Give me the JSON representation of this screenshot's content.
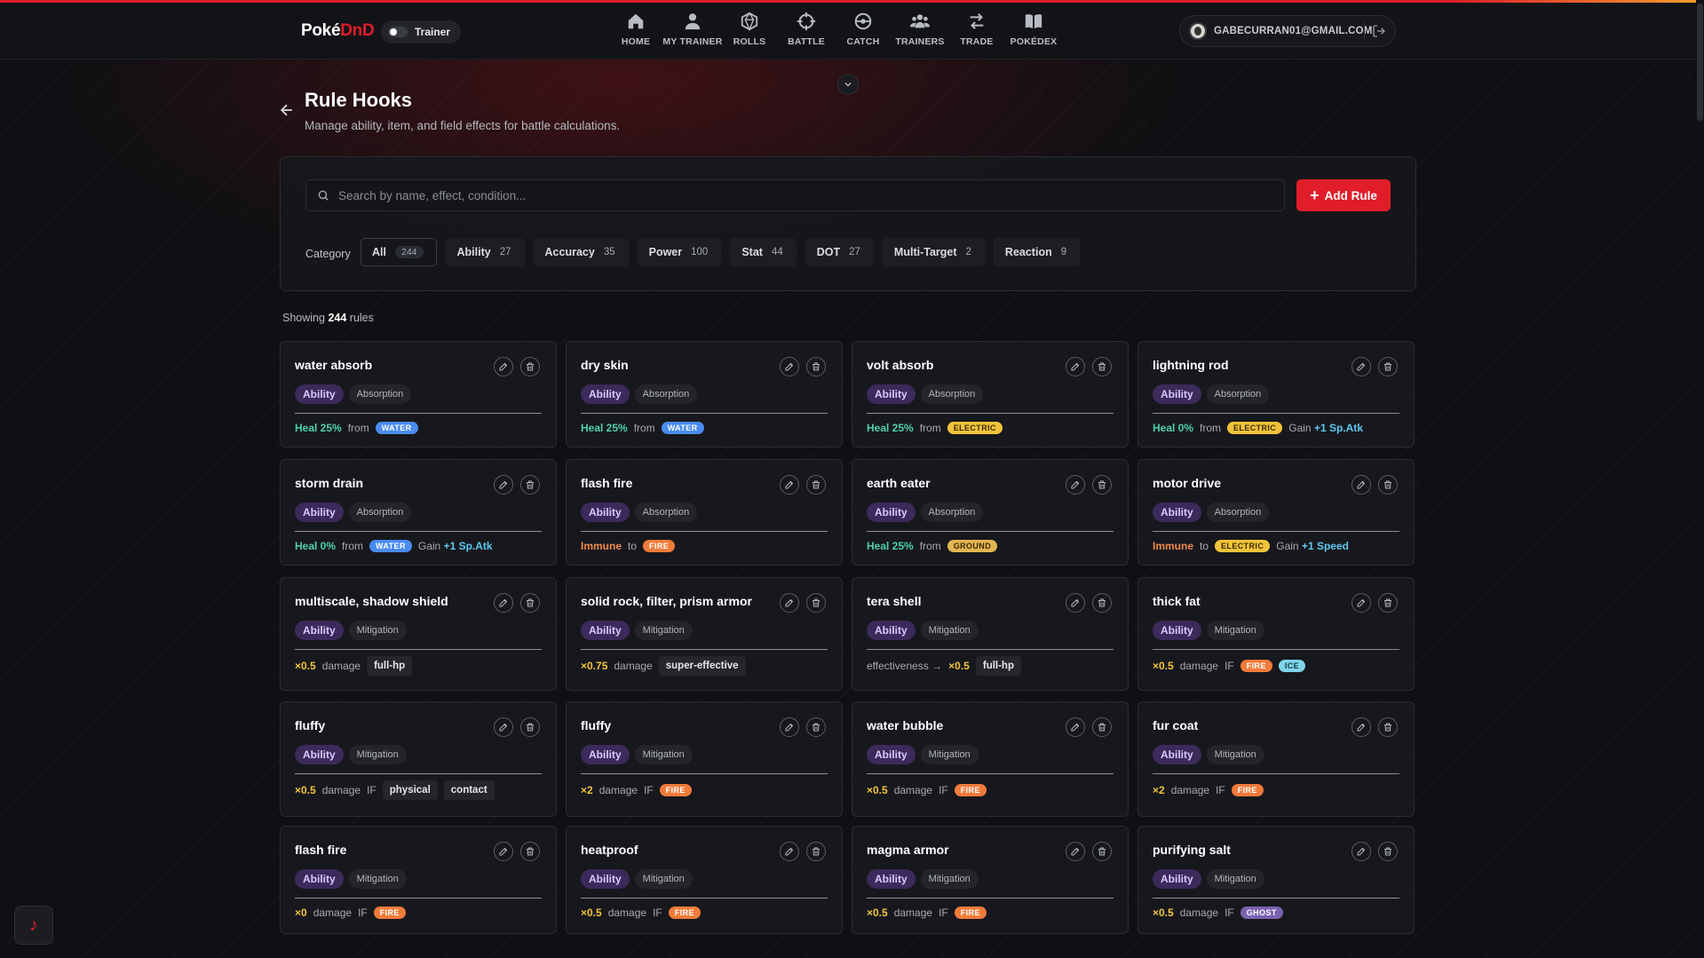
{
  "brand": {
    "part1": "Poké",
    "part2": "DnD"
  },
  "mode_toggle_label": "Trainer",
  "nav": [
    {
      "label": "HOME",
      "icon": "home-icon"
    },
    {
      "label": "MY TRAINER",
      "icon": "user-icon"
    },
    {
      "label": "ROLLS",
      "icon": "dice-icon"
    },
    {
      "label": "BATTLE",
      "icon": "crosshair-icon"
    },
    {
      "label": "CATCH",
      "icon": "pokeball-icon"
    },
    {
      "label": "TRAINERS",
      "icon": "users-icon"
    },
    {
      "label": "TRADE",
      "icon": "swap-icon"
    },
    {
      "label": "POKÉDEX",
      "icon": "book-icon"
    }
  ],
  "user": {
    "email": "GABECURRAN01@GMAIL.COM"
  },
  "page": {
    "title": "Rule Hooks",
    "subtitle": "Manage ability, item, and field effects for battle calculations."
  },
  "search": {
    "placeholder": "Search by name, effect, condition..."
  },
  "add_button": "Add Rule",
  "category_label": "Category",
  "categories": [
    {
      "label": "All",
      "count": "244",
      "active": true
    },
    {
      "label": "Ability",
      "count": "27"
    },
    {
      "label": "Accuracy",
      "count": "35"
    },
    {
      "label": "Power",
      "count": "100"
    },
    {
      "label": "Stat",
      "count": "44"
    },
    {
      "label": "DOT",
      "count": "27"
    },
    {
      "label": "Multi-Target",
      "count": "2"
    },
    {
      "label": "Reaction",
      "count": "9"
    }
  ],
  "showing": {
    "prefix": "Showing",
    "count": "244",
    "suffix": "rules"
  },
  "cards": [
    {
      "name": "water absorb",
      "tag": "Ability",
      "sub": "Absorption",
      "effect": [
        {
          "k": "heal",
          "t": "Heal 25%"
        },
        {
          "k": "txt",
          "t": "from"
        },
        {
          "k": "type",
          "t": "WATER",
          "c": "water"
        }
      ]
    },
    {
      "name": "dry skin",
      "tag": "Ability",
      "sub": "Absorption",
      "effect": [
        {
          "k": "heal",
          "t": "Heal 25%"
        },
        {
          "k": "txt",
          "t": "from"
        },
        {
          "k": "type",
          "t": "WATER",
          "c": "water"
        }
      ]
    },
    {
      "name": "volt absorb",
      "tag": "Ability",
      "sub": "Absorption",
      "effect": [
        {
          "k": "heal",
          "t": "Heal 25%"
        },
        {
          "k": "txt",
          "t": "from"
        },
        {
          "k": "type",
          "t": "ELECTRIC",
          "c": "electric"
        }
      ]
    },
    {
      "name": "lightning rod",
      "tag": "Ability",
      "sub": "Absorption",
      "effect": [
        {
          "k": "heal",
          "t": "Heal 0%"
        },
        {
          "k": "txt",
          "t": "from"
        },
        {
          "k": "type",
          "t": "ELECTRIC",
          "c": "electric"
        },
        {
          "k": "gain",
          "t": "Gain",
          "v": "+1 Sp.Atk"
        }
      ]
    },
    {
      "name": "storm drain",
      "tag": "Ability",
      "sub": "Absorption",
      "effect": [
        {
          "k": "heal",
          "t": "Heal 0%"
        },
        {
          "k": "txt",
          "t": "from"
        },
        {
          "k": "type",
          "t": "WATER",
          "c": "water"
        },
        {
          "k": "gain",
          "t": "Gain",
          "v": "+1 Sp.Atk"
        }
      ]
    },
    {
      "name": "flash fire",
      "tag": "Ability",
      "sub": "Absorption",
      "effect": [
        {
          "k": "immune",
          "t": "Immune"
        },
        {
          "k": "txt",
          "t": "to"
        },
        {
          "k": "type",
          "t": "FIRE",
          "c": "fire"
        }
      ]
    },
    {
      "name": "earth eater",
      "tag": "Ability",
      "sub": "Absorption",
      "effect": [
        {
          "k": "heal",
          "t": "Heal 25%"
        },
        {
          "k": "txt",
          "t": "from"
        },
        {
          "k": "type",
          "t": "GROUND",
          "c": "ground"
        }
      ]
    },
    {
      "name": "motor drive",
      "tag": "Ability",
      "sub": "Absorption",
      "effect": [
        {
          "k": "immune",
          "t": "Immune"
        },
        {
          "k": "txt",
          "t": "to"
        },
        {
          "k": "type",
          "t": "ELECTRIC",
          "c": "electric"
        },
        {
          "k": "gain",
          "t": "Gain",
          "v": "+1 Speed"
        }
      ]
    },
    {
      "name": "multiscale, shadow shield",
      "tag": "Ability",
      "sub": "Mitigation",
      "effect": [
        {
          "k": "mult",
          "t": "×0.5"
        },
        {
          "k": "txt",
          "t": "damage"
        },
        {
          "k": "chip",
          "t": "full-hp"
        }
      ]
    },
    {
      "name": "solid rock, filter, prism armor",
      "tag": "Ability",
      "sub": "Mitigation",
      "effect": [
        {
          "k": "mult",
          "t": "×0.75"
        },
        {
          "k": "txt",
          "t": "damage"
        },
        {
          "k": "chip",
          "t": "super-effective"
        }
      ]
    },
    {
      "name": "tera shell",
      "tag": "Ability",
      "sub": "Mitigation",
      "effect": [
        {
          "k": "txt",
          "t": "effectiveness →"
        },
        {
          "k": "mult",
          "t": "×0.5"
        },
        {
          "k": "chip",
          "t": "full-hp"
        }
      ]
    },
    {
      "name": "thick fat",
      "tag": "Ability",
      "sub": "Mitigation",
      "effect": [
        {
          "k": "mult",
          "t": "×0.5"
        },
        {
          "k": "txt",
          "t": "damage"
        },
        {
          "k": "txt",
          "t": "IF"
        },
        {
          "k": "type",
          "t": "FIRE",
          "c": "fire"
        },
        {
          "k": "type",
          "t": "ICE",
          "c": "ice"
        }
      ]
    },
    {
      "name": "fluffy",
      "tag": "Ability",
      "sub": "Mitigation",
      "effect": [
        {
          "k": "mult",
          "t": "×0.5"
        },
        {
          "k": "txt",
          "t": "damage"
        },
        {
          "k": "txt",
          "t": "IF"
        },
        {
          "k": "chip",
          "t": "physical"
        },
        {
          "k": "chip",
          "t": "contact"
        }
      ]
    },
    {
      "name": "fluffy",
      "tag": "Ability",
      "sub": "Mitigation",
      "effect": [
        {
          "k": "mult",
          "t": "×2"
        },
        {
          "k": "txt",
          "t": "damage"
        },
        {
          "k": "txt",
          "t": "IF"
        },
        {
          "k": "type",
          "t": "FIRE",
          "c": "fire"
        }
      ]
    },
    {
      "name": "water bubble",
      "tag": "Ability",
      "sub": "Mitigation",
      "effect": [
        {
          "k": "mult",
          "t": "×0.5"
        },
        {
          "k": "txt",
          "t": "damage"
        },
        {
          "k": "txt",
          "t": "IF"
        },
        {
          "k": "type",
          "t": "FIRE",
          "c": "fire"
        }
      ]
    },
    {
      "name": "fur coat",
      "tag": "Ability",
      "sub": "Mitigation",
      "effect": [
        {
          "k": "mult",
          "t": "×2"
        },
        {
          "k": "txt",
          "t": "damage"
        },
        {
          "k": "txt",
          "t": "IF"
        },
        {
          "k": "type",
          "t": "FIRE",
          "c": "fire"
        }
      ]
    },
    {
      "name": "flash fire",
      "tag": "Ability",
      "sub": "Mitigation",
      "effect": [
        {
          "k": "mult",
          "t": "×0"
        },
        {
          "k": "txt",
          "t": "damage"
        },
        {
          "k": "txt",
          "t": "IF"
        },
        {
          "k": "type",
          "t": "FIRE",
          "c": "fire"
        }
      ]
    },
    {
      "name": "heatproof",
      "tag": "Ability",
      "sub": "Mitigation",
      "effect": [
        {
          "k": "mult",
          "t": "×0.5"
        },
        {
          "k": "txt",
          "t": "damage"
        },
        {
          "k": "txt",
          "t": "IF"
        },
        {
          "k": "type",
          "t": "FIRE",
          "c": "fire"
        }
      ]
    },
    {
      "name": "magma armor",
      "tag": "Ability",
      "sub": "Mitigation",
      "effect": [
        {
          "k": "mult",
          "t": "×0.5"
        },
        {
          "k": "txt",
          "t": "damage"
        },
        {
          "k": "txt",
          "t": "IF"
        },
        {
          "k": "type",
          "t": "FIRE",
          "c": "fire"
        }
      ]
    },
    {
      "name": "purifying salt",
      "tag": "Ability",
      "sub": "Mitigation",
      "effect": [
        {
          "k": "mult",
          "t": "×0.5"
        },
        {
          "k": "txt",
          "t": "damage"
        },
        {
          "k": "txt",
          "t": "IF"
        },
        {
          "k": "type",
          "t": "GHOST",
          "c": "ghost"
        }
      ]
    }
  ]
}
